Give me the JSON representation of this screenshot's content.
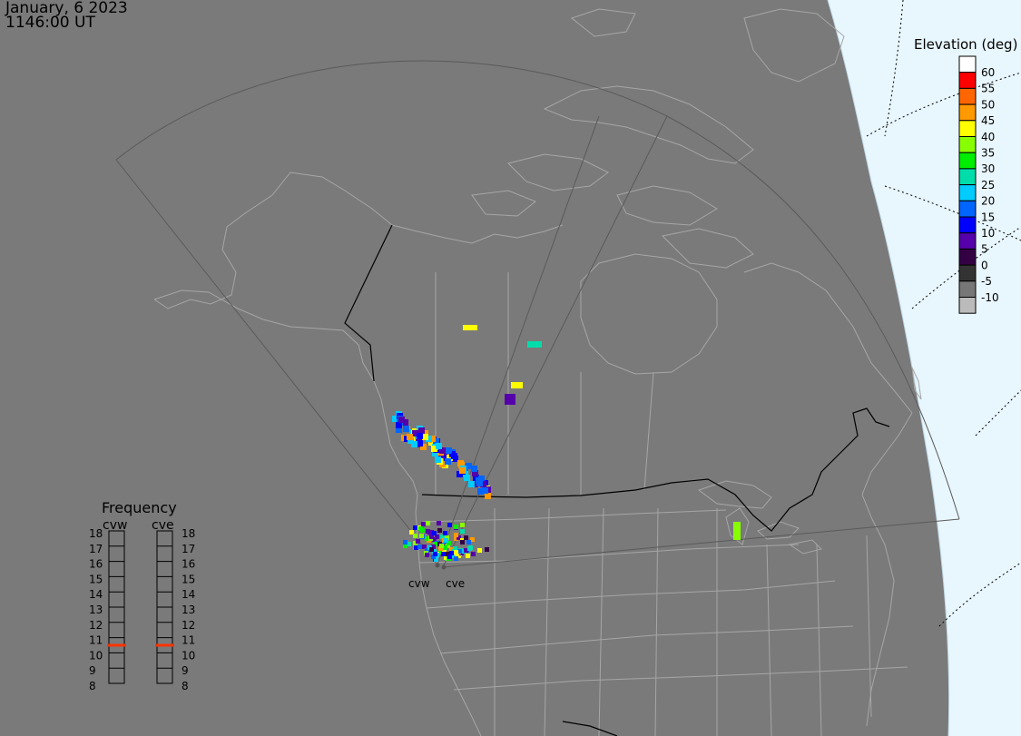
{
  "header": {
    "date": "January, 6 2023",
    "time": "1146:00 UT"
  },
  "colors": {
    "background": "#7a7a7a",
    "land_outline": "#a6a6a6",
    "border": "#000000",
    "fov_line": "#5a5a5a",
    "daylight": "#e8f6fd"
  },
  "elevation_legend": {
    "title": "Elevation (deg)",
    "levels": [
      {
        "label": "60",
        "color": "#ffffff"
      },
      {
        "label": "55",
        "color": "#ff0000"
      },
      {
        "label": "50",
        "color": "#ff6600"
      },
      {
        "label": "45",
        "color": "#ff9900"
      },
      {
        "label": "40",
        "color": "#ffff00"
      },
      {
        "label": "35",
        "color": "#88ff00"
      },
      {
        "label": "30",
        "color": "#00ee00"
      },
      {
        "label": "25",
        "color": "#00ddaa"
      },
      {
        "label": "20",
        "color": "#00ccff"
      },
      {
        "label": "15",
        "color": "#0066ff"
      },
      {
        "label": "10",
        "color": "#0000ff"
      },
      {
        "label": "5",
        "color": "#5500aa"
      },
      {
        "label": "0",
        "color": "#330044"
      },
      {
        "label": "-5",
        "color": "#333333"
      },
      {
        "label": "-10",
        "color": "#777777"
      },
      {
        "label": "",
        "color": "#bbbbbb"
      }
    ]
  },
  "frequency_panel": {
    "title": "Frequency",
    "radars": [
      "cvw",
      "cve"
    ],
    "scale": [
      "18",
      "17",
      "16",
      "15",
      "14",
      "13",
      "12",
      "11",
      "10",
      "9",
      "8"
    ],
    "current_freq_mhz": [
      10.5,
      10.5
    ],
    "marker_color": "#ff3300"
  },
  "radar_sites": [
    "cvw",
    "cve"
  ]
}
